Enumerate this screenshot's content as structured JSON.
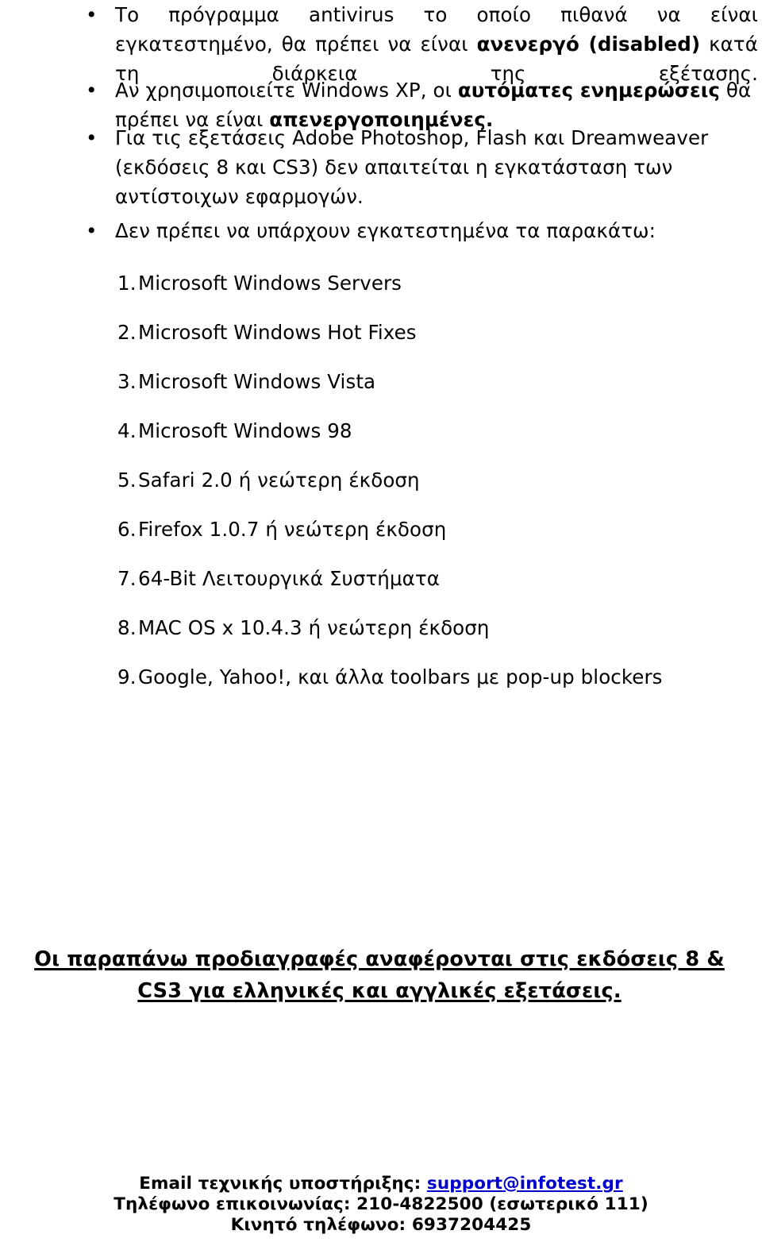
{
  "document": {
    "language": "el",
    "page_background": "#ffffff",
    "text_color": "#000000",
    "link_color": "#0000CC"
  },
  "bullets": {
    "marker": "•",
    "items": [
      {
        "name": "antivirus-requirement",
        "segments": [
          {
            "text": "Το πρόγραμμα antivirus το οποίο πιθανά να είναι εγκατεστημένο, θα πρέπει να είναι ",
            "bold": false
          },
          {
            "text": "ανενεργό (disabled)",
            "bold": true
          },
          {
            "text": " κατά τη διάρκεια της εξέτασης.",
            "bold": false
          }
        ],
        "plain": "Το πρόγραμμα antivirus το οποίο πιθανά να είναι εγκατεστημένο, θα πρέπει να είναι ανενεργό (disabled) κατά τη διάρκεια της εξέτασης."
      },
      {
        "name": "windows-xp-updates-requirement",
        "segments": [
          {
            "text": "Αν χρησιμοποιείτε Windows XP, οι ",
            "bold": false
          },
          {
            "text": "αυτόματες ενημερώσεις",
            "bold": true
          },
          {
            "text": " θα πρέπει να είναι ",
            "bold": false
          },
          {
            "text": "απενεργοποιημένες.",
            "bold": true
          }
        ],
        "plain": "Αν χρησιμοποιείτε Windows XP, οι αυτόματες ενημερώσεις θα πρέπει να είναι απενεργοποιημένες."
      },
      {
        "name": "adobe-exams-requirement",
        "segments": [
          {
            "text": "Για τις εξετάσεις Adobe Photoshop, Flash και Dreamweaver (εκδόσεις 8 και CS3) δεν απαιτείται η εγκατάσταση των αντίστοιχων εφαρμογών.",
            "bold": false
          }
        ],
        "plain": "Για τις εξετάσεις Adobe Photoshop, Flash και Dreamweaver (εκδόσεις 8 και CS3) δεν απαιτείται η εγκατάσταση των αντίστοιχων εφαρμογών."
      },
      {
        "name": "not-installed-intro",
        "segments": [
          {
            "text": "Δεν πρέπει να υπάρχουν εγκατεστημένα τα παρακάτω:",
            "bold": false
          }
        ],
        "plain": "Δεν πρέπει να υπάρχουν εγκατεστημένα τα παρακάτω:"
      }
    ]
  },
  "numbered_list": {
    "items": [
      {
        "number": "1.",
        "label": "Microsoft Windows Servers"
      },
      {
        "number": "2.",
        "label": "Microsoft Windows Hot Fixes"
      },
      {
        "number": "3.",
        "label": "Microsoft Windows Vista"
      },
      {
        "number": "4.",
        "label": "Microsoft Windows 98"
      },
      {
        "number": "5.",
        "label": "Safari 2.0 ή νεώτερη έκδοση"
      },
      {
        "number": "6.",
        "label": "Firefox 1.0.7 ή νεώτερη έκδοση"
      },
      {
        "number": "7.",
        "label": "64-Bit Λειτουργικά Συστήματα"
      },
      {
        "number": "8.",
        "label": "MAC OS x 10.4.3 ή νεώτερη έκδοση"
      },
      {
        "number": "9.",
        "label": "Google, Yahoo!, και άλλα toolbars με pop-up blockers"
      }
    ]
  },
  "notice": {
    "line1": "Οι παραπάνω προδιαγραφές αναφέρονται στις εκδόσεις 8 &",
    "line2": "CS3 για ελληνικές και αγγλικές εξετάσεις."
  },
  "footer": {
    "email_label": "Email τεχνικής υποστήριξης:",
    "email_address": "support@infotest.gr",
    "phone_line": "Τηλέφωνο επικοινωνίας: 210-4822500 (εσωτερικό 111)",
    "mobile_line": "Κινητό τηλέφωνο: 6937204425"
  }
}
